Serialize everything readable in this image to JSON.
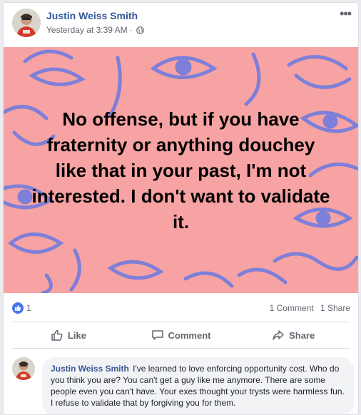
{
  "post": {
    "author": "Justin Weiss Smith",
    "timestamp": "Yesterday at 3:39 AM",
    "separator": "·",
    "privacy_icon": "globe-icon",
    "more_icon": "•••",
    "status_text": "No offense, but if you have fraternity or anything douchey like that in your past, I'm not interested. I don't want to validate it.",
    "background_color": "#f7a3a3",
    "pattern_color": "#7d7fd8"
  },
  "stats": {
    "like_count": "1",
    "comments": "1 Comment",
    "shares": "1 Share"
  },
  "actions": {
    "like_label": "Like",
    "comment_label": "Comment",
    "share_label": "Share"
  },
  "comment": {
    "author": "Justin Weiss Smith",
    "text": "I've learned to love enforcing opportunity cost. Who do you think you are? You can't get a guy like me anymore. There are some people even you can't have. Your exes thought your trysts were harmless fun. I refuse to validate that by forgiving you for them."
  },
  "colors": {
    "link": "#365899",
    "like_blue": "#4a76e8",
    "muted": "#616770"
  }
}
